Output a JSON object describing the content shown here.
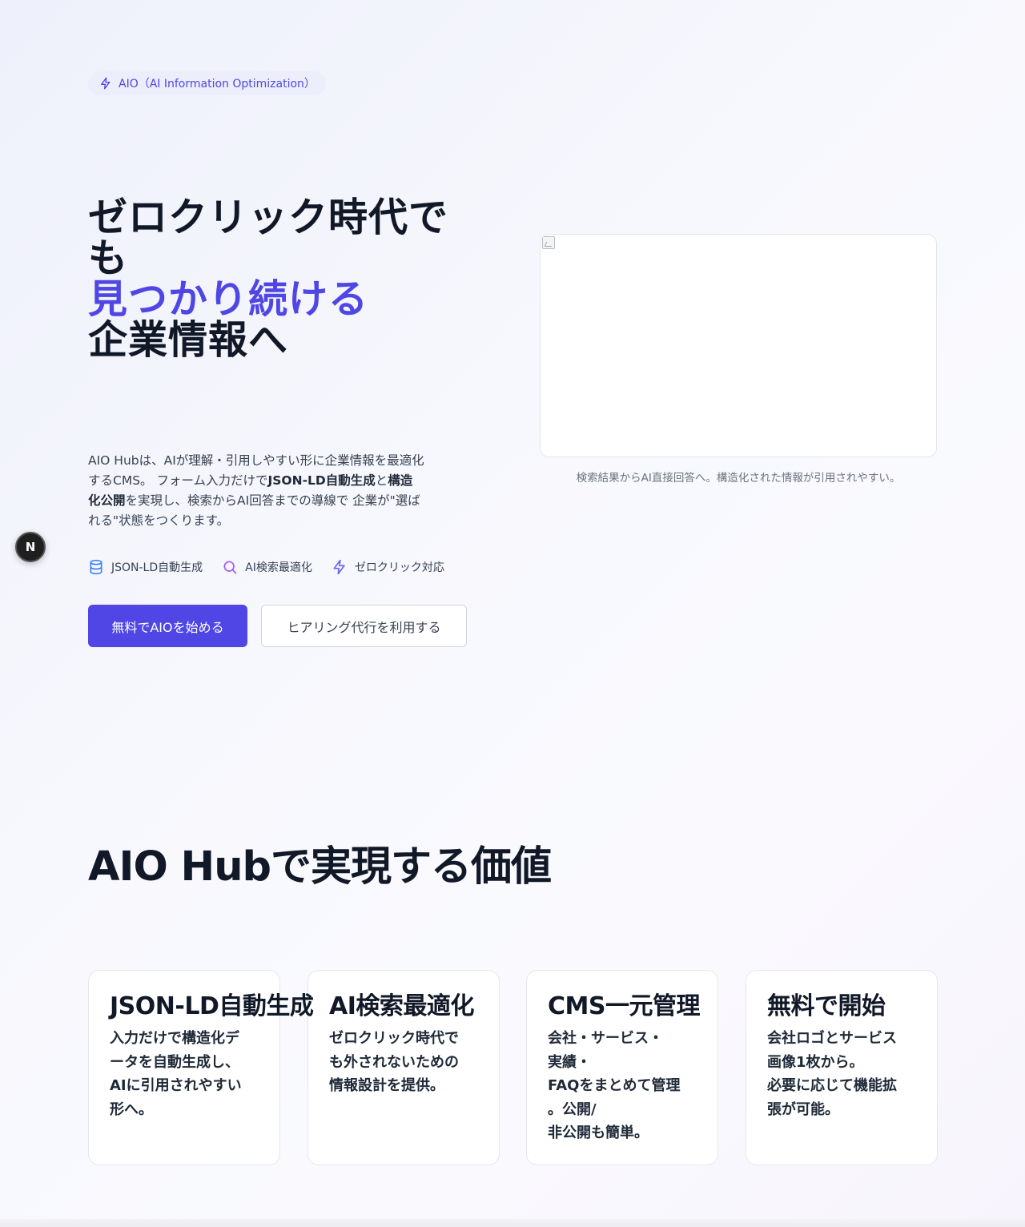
{
  "hero": {
    "badge": "AIO（AI Information Optimization）",
    "title_line1": "ゼロクリック時代でも",
    "title_accent": "見つかり続ける",
    "title_line3": "企業情報へ",
    "desc_part1": "AIO Hubは、AIが理解・引用しやすい形に企業情報を最適化するCMS。 フォーム入力だけで",
    "desc_bold1": "JSON-LD自動生成",
    "desc_part2": "と",
    "desc_bold2": "構造化公開",
    "desc_part3": "を実現し、検索からAI回答までの導線で 企業が\"選ばれる\"状態をつくります。",
    "features": [
      {
        "label": "JSON-LD自動生成",
        "icon": "database-icon",
        "color": "#3b82f6"
      },
      {
        "label": "AI検索最適化",
        "icon": "search-icon",
        "color": "#a855f7"
      },
      {
        "label": "ゼロクリック対応",
        "icon": "lightning-icon",
        "color": "#6366f1"
      }
    ],
    "primary_button": "無料でAIOを始める",
    "secondary_button": "ヒアリング代行を利用する",
    "image_caption": "検索結果からAI直接回答へ。構造化された情報が引用されやすい。"
  },
  "dev_badge": "N",
  "values": {
    "title": "AIO Hubで実現する価値",
    "cards": [
      {
        "title": "JSON-LD自動生成",
        "body": "入力だけで構造化デ\nータを自動生成し、\nAIに引用されやすい\n形へ。"
      },
      {
        "title": "AI検索最適化",
        "body": "ゼロクリック時代で\nも外されないための\n情報設計を提供。"
      },
      {
        "title": "CMS一元管理",
        "body": "会社・サービス・\n実績・\nFAQをまとめて管理\n。公開/\n非公開も簡単。"
      },
      {
        "title": "無料で開始",
        "body": "会社ロゴとサービス\n画像1枚から。\n必要に応じて機能拡\n張が可能。"
      }
    ]
  },
  "colors": {
    "accent": "#4f46e5",
    "text": "#111827"
  }
}
